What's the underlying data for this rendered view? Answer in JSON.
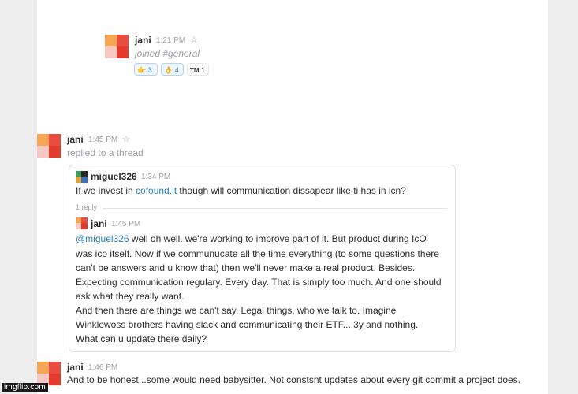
{
  "joined": {
    "user": "jani",
    "time": "1:21 PM",
    "text": "joined #general",
    "reactions": [
      {
        "icon": "pointing-hand",
        "emoji": "👉",
        "count": "3"
      },
      {
        "icon": "ok-hand",
        "emoji": "👌",
        "count": "4"
      },
      {
        "icon": "trademark",
        "emoji": "TM",
        "count": "1"
      }
    ]
  },
  "reply_event": {
    "user": "jani",
    "time": "1:45 PM",
    "text": "replied to a thread"
  },
  "thread": {
    "parent": {
      "user": "miguel326",
      "time": "1:34 PM",
      "text_before": "If we invest in ",
      "link": "cofound.it",
      "text_after": " though will communication dissapear like ti has in icn?"
    },
    "reply_count": "1 reply",
    "reply": {
      "user": "jani",
      "time": "1:45 PM",
      "mention": "@miguel326",
      "first_line_rest": " well oh well. we're working to improve part of it. But product during IcO",
      "lines": [
        "was ico itself. Now if we communucate all the time everything (to some questions there",
        "can't be answers and u know that) then we'll never make a real product. Besides.",
        "Expecting communication regulary. Every day. That is simply too much. And one should",
        "ask what they really want.",
        "And then there are things we can't say. Legal things, who we talk to. Imagine",
        "Winklewoss brothers having slack and communicating their ETF....3y and nothing.",
        "What can u update there daily?"
      ]
    }
  },
  "last_message": {
    "user": "jani",
    "time": "1:46 PM",
    "text": "And to be honest...some would need babysitter. Not constsnt updates about every git commit a project does."
  },
  "watermark": "imgflip.com",
  "colors": {
    "link": "#2a80b9",
    "background": "#ededed",
    "avatar_orange": "#f4a652",
    "avatar_red": "#e94d3f"
  }
}
